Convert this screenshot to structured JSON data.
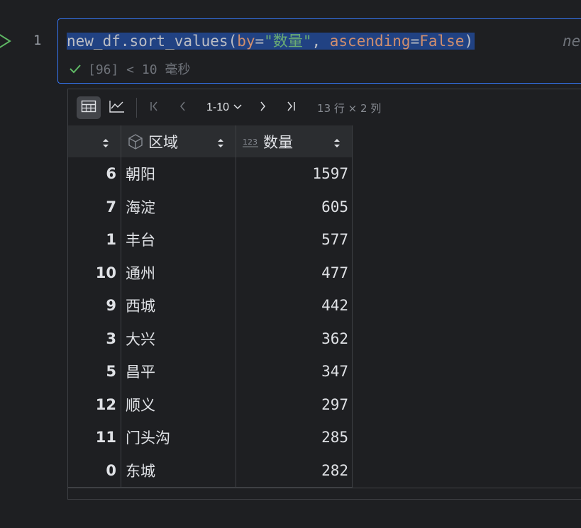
{
  "editor": {
    "line_number": "1",
    "code": {
      "prefix": "new_df.sort_values(",
      "param1": "by",
      "eq1": "=",
      "str1": "\"数量\"",
      "comma": ", ",
      "param2": "ascending",
      "eq2": "=",
      "value2": "False",
      "suffix": ")"
    },
    "ghost_text": "ne",
    "status": "[96] < 10 毫秒"
  },
  "output": {
    "toolbar": {
      "page_range": "1-10",
      "shape": "13 行 × 2 列"
    },
    "columns": [
      {
        "label": "区域",
        "icon": "cube-icon"
      },
      {
        "label": "数量",
        "icon": "numeric-123-icon"
      }
    ],
    "rows": [
      {
        "index": "6",
        "area": "朝阳",
        "count": "1597"
      },
      {
        "index": "7",
        "area": "海淀",
        "count": "605"
      },
      {
        "index": "1",
        "area": "丰台",
        "count": "577"
      },
      {
        "index": "10",
        "area": "通州",
        "count": "477"
      },
      {
        "index": "9",
        "area": "西城",
        "count": "442"
      },
      {
        "index": "3",
        "area": "大兴",
        "count": "362"
      },
      {
        "index": "5",
        "area": "昌平",
        "count": "347"
      },
      {
        "index": "12",
        "area": "顺义",
        "count": "297"
      },
      {
        "index": "11",
        "area": "门头沟",
        "count": "285"
      },
      {
        "index": "0",
        "area": "东城",
        "count": "282"
      }
    ]
  },
  "colors": {
    "background": "#1e1f22",
    "selection": "#214283",
    "cell_border": "#3574f0",
    "success": "#5fb865"
  }
}
